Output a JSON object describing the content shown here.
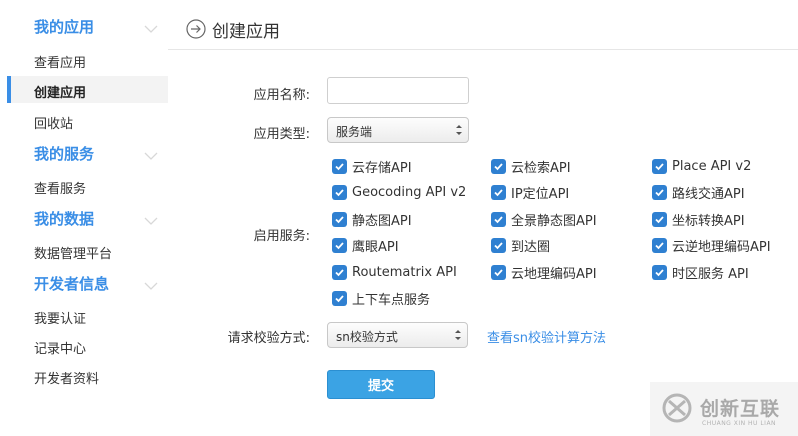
{
  "sidebar": {
    "groups": [
      {
        "title": "我的应用",
        "items": [
          "查看应用",
          "创建应用",
          "回收站"
        ]
      },
      {
        "title": "我的服务",
        "items": [
          "查看服务"
        ]
      },
      {
        "title": "我的数据",
        "items": [
          "数据管理平台"
        ]
      },
      {
        "title": "开发者信息",
        "items": [
          "我要认证",
          "记录中心",
          "开发者资料"
        ]
      }
    ],
    "active_item": "创建应用"
  },
  "header": {
    "title": "创建应用"
  },
  "form": {
    "app_name_label": "应用名称:",
    "app_name_value": "",
    "app_type_label": "应用类型:",
    "app_type_value": "服务端",
    "services_label": "启用服务:",
    "services": [
      "云存储API",
      "云检索API",
      "Place API v2",
      "Geocoding API v2",
      "IP定位API",
      "路线交通API",
      "静态图API",
      "全景静态图API",
      "坐标转换API",
      "鹰眼API",
      "到达圈",
      "云逆地理编码API",
      "Routematrix API",
      "云地理编码API",
      "时区服务 API",
      "上下车点服务"
    ],
    "verify_label": "请求校验方式:",
    "verify_value": "sn校验方式",
    "verify_link": "查看sn校验计算方法",
    "submit_label": "提交"
  },
  "watermark": {
    "text": "创新互联",
    "sub": "CHUANG XIN HU LIAN"
  },
  "colors": {
    "accent": "#3a8ee6",
    "checkbox": "#2f80d1",
    "button": "#3ba3e4"
  }
}
